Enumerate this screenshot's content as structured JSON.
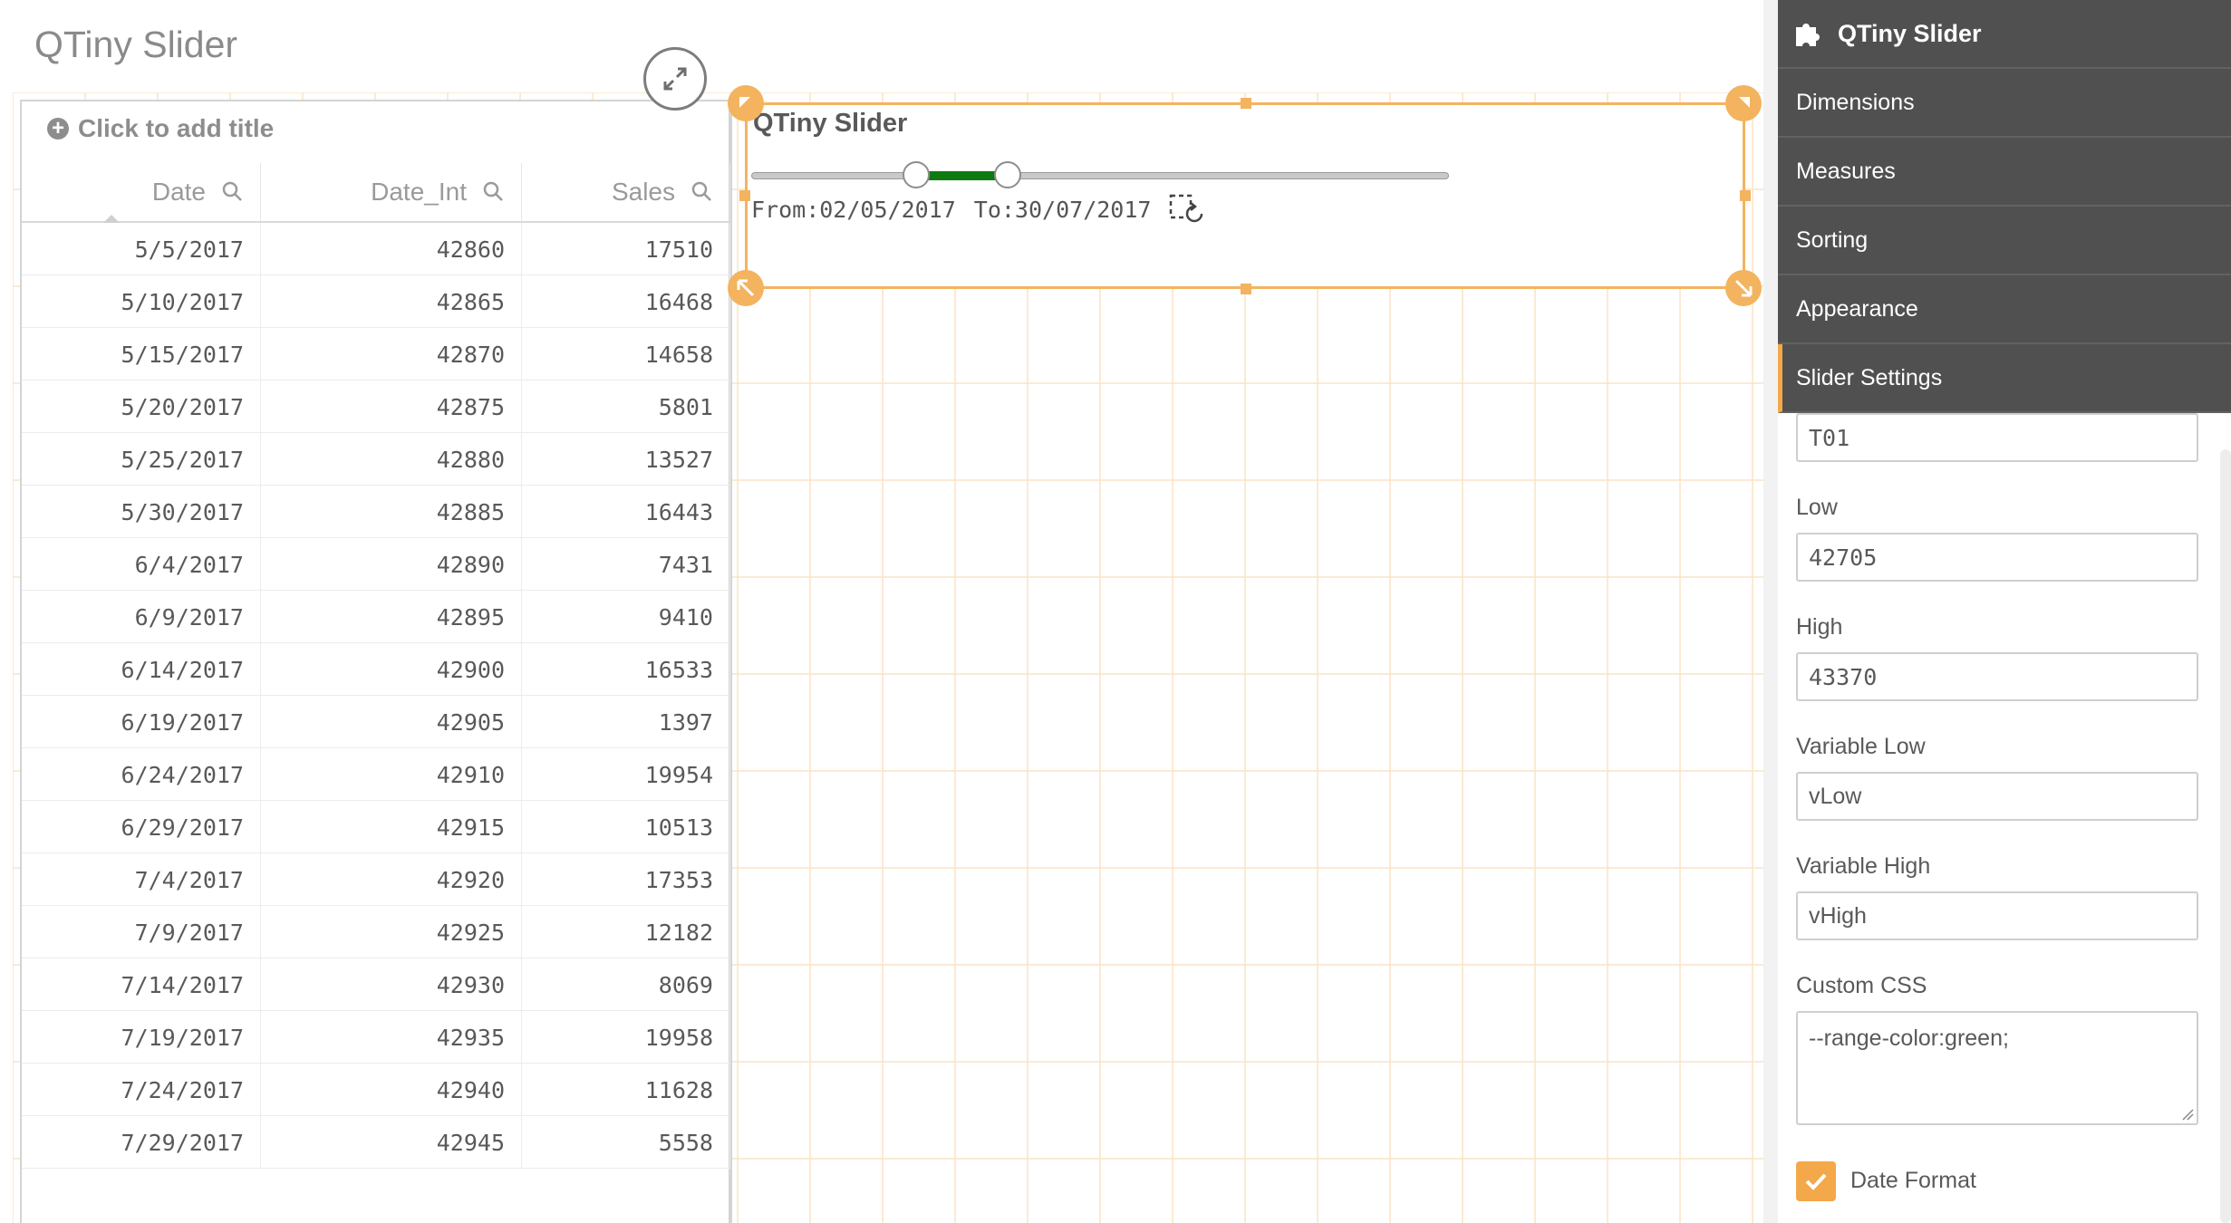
{
  "sheet": {
    "title": "QTiny Slider"
  },
  "table": {
    "add_title_label": "Click to add title",
    "columns": [
      "Date",
      "Date_Int",
      "Sales"
    ],
    "rows": [
      [
        "5/5/2017",
        "42860",
        "17510"
      ],
      [
        "5/10/2017",
        "42865",
        "16468"
      ],
      [
        "5/15/2017",
        "42870",
        "14658"
      ],
      [
        "5/20/2017",
        "42875",
        "5801"
      ],
      [
        "5/25/2017",
        "42880",
        "13527"
      ],
      [
        "5/30/2017",
        "42885",
        "16443"
      ],
      [
        "6/4/2017",
        "42890",
        "7431"
      ],
      [
        "6/9/2017",
        "42895",
        "9410"
      ],
      [
        "6/14/2017",
        "42900",
        "16533"
      ],
      [
        "6/19/2017",
        "42905",
        "1397"
      ],
      [
        "6/24/2017",
        "42910",
        "19954"
      ],
      [
        "6/29/2017",
        "42915",
        "10513"
      ],
      [
        "7/4/2017",
        "42920",
        "17353"
      ],
      [
        "7/9/2017",
        "42925",
        "12182"
      ],
      [
        "7/14/2017",
        "42930",
        "8069"
      ],
      [
        "7/19/2017",
        "42935",
        "19958"
      ],
      [
        "7/24/2017",
        "42940",
        "11628"
      ],
      [
        "7/29/2017",
        "42945",
        "5558"
      ]
    ]
  },
  "slider": {
    "title": "QTiny Slider",
    "from_text": "From:02/05/2017",
    "to_text": "To:30/07/2017",
    "range_color": "#0f7a0f",
    "low_fraction": 0.236,
    "high_fraction": 0.367,
    "reset_icon": "reset-selection-icon"
  },
  "panel": {
    "header": "QTiny Slider",
    "header_icon": "puzzle-piece-icon",
    "menu": [
      "Dimensions",
      "Measures",
      "Sorting",
      "Appearance",
      "Slider Settings"
    ],
    "active_menu": "Slider Settings",
    "id_value": "T01",
    "low_label": "Low",
    "low_value": "42705",
    "high_label": "High",
    "high_value": "43370",
    "var_low_label": "Variable Low",
    "var_low_value": "vLow",
    "var_high_label": "Variable High",
    "var_high_value": "vHigh",
    "css_label": "Custom CSS",
    "css_value": "--range-color:green;",
    "date_format_label": "Date Format",
    "date_format_checked": true
  },
  "colors": {
    "accent": "#f3a84a",
    "selection": "#f3b35f",
    "panel_bg": "#505050"
  }
}
